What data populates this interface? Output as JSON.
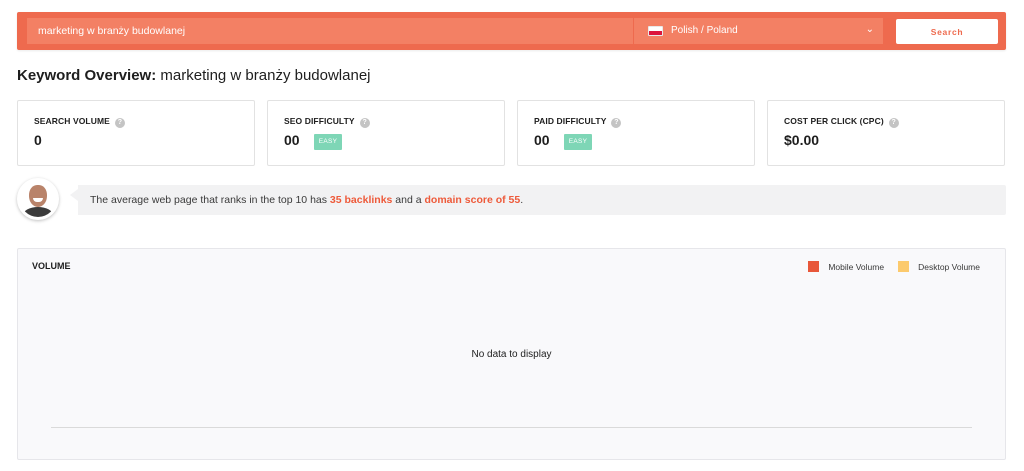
{
  "search": {
    "query": "marketing w branży budowlanej",
    "language": "Polish / Poland",
    "button_label": "Search"
  },
  "title": {
    "prefix": "Keyword Overview:",
    "keyword": "marketing w branży budowlanej"
  },
  "metrics": [
    {
      "label": "SEARCH VOLUME",
      "value": "0",
      "badge": ""
    },
    {
      "label": "SEO DIFFICULTY",
      "value": "00",
      "badge": "EASY"
    },
    {
      "label": "PAID DIFFICULTY",
      "value": "00",
      "badge": "EASY"
    },
    {
      "label": "COST PER CLICK (CPC)",
      "value": "$0.00",
      "badge": ""
    }
  ],
  "tip": {
    "part1": "The average web page that ranks in the top 10 has ",
    "backlinks": "35 backlinks",
    "part2": " and a ",
    "domain_score": "domain score of 55",
    "part3": "."
  },
  "volume": {
    "title": "VOLUME",
    "no_data": "No data to display",
    "legend": [
      {
        "label": "Mobile Volume",
        "color": "#e8573a"
      },
      {
        "label": "Desktop Volume",
        "color": "#fcca6d"
      }
    ]
  },
  "colors": {
    "accent": "#ee6a4e",
    "easy_badge": "#7ed6b6",
    "highlight": "#ee5a3a"
  },
  "icons": {
    "help": "?",
    "chevron": "⌄"
  }
}
